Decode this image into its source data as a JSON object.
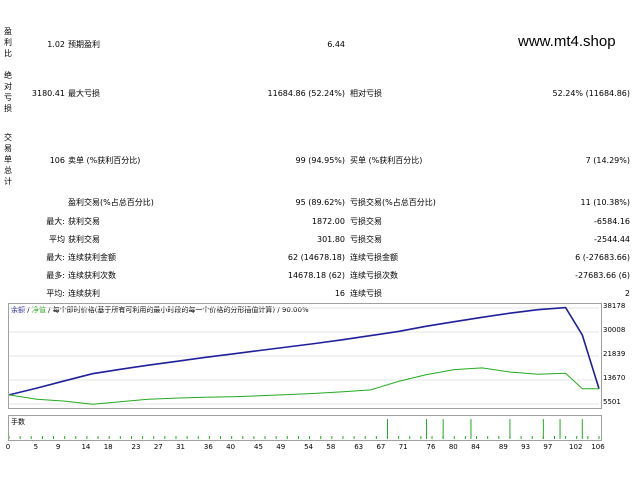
{
  "watermark": "www.mt4.shop",
  "side_labels": {
    "profit_ratio": "盈利比",
    "absolute_drawdown": "绝对亏损",
    "trade_summary": "交易单总计"
  },
  "rows": {
    "r1": {
      "left_value": "1.02",
      "label1": "预期盈利",
      "value1": "6.44"
    },
    "r2": {
      "left_value": "3180.41",
      "label1": "最大亏损",
      "value1": "11684.86 (52.24%)",
      "label2": "相对亏损",
      "value2": "52.24% (11684.86)"
    },
    "r3": {
      "left_value": "106",
      "label1": "卖单 (%获利百分比)",
      "value1": "99 (94.95%)",
      "label2": "买单 (%获利百分比)",
      "value2": "7 (14.29%)"
    },
    "r4": {
      "label1": "盈利交易(%占总百分比)",
      "value1": "95 (89.62%)",
      "label2": "亏损交易(%占总百分比)",
      "value2": "11 (10.38%)"
    },
    "r5": {
      "prefix": "最大:",
      "label1": "获利交易",
      "value1": "1872.00",
      "label2": "亏损交易",
      "value2": "-6584.16"
    },
    "r6": {
      "prefix": "平均",
      "label1": "获利交易",
      "value1": "301.80",
      "label2": "亏损交易",
      "value2": "-2544.44"
    },
    "r7": {
      "prefix": "最大:",
      "label1": "连续获利金额",
      "value1": "62 (14678.18)",
      "label2": "连续亏损金额",
      "value2": "6 (-27683.66)"
    },
    "r8": {
      "prefix": "最多:",
      "label1": "连续获利次数",
      "value1": "14678.18 (62)",
      "label2": "连续亏损次数",
      "value2": "-27683.66 (6)"
    },
    "r9": {
      "prefix": "平均:",
      "label1": "连续获利",
      "value1": "16",
      "label2": "连续亏损",
      "value2": "2"
    }
  },
  "chart": {
    "legend_balance": "余额",
    "legend_sep1": "/",
    "legend_equity": "净值",
    "legend_rest": "/ 每个即时价格(基于所有可利用的最小时段的每一个价格的分形插值计算) / 90.00%",
    "volume_label": "手数",
    "colors": {
      "balance": "#1f1f9c",
      "equity": "#22aa22",
      "volume": "#22aa22"
    }
  },
  "chart_data": {
    "type": "line",
    "x": [
      0,
      5,
      10,
      15,
      20,
      25,
      30,
      35,
      40,
      45,
      50,
      55,
      60,
      65,
      70,
      75,
      80,
      85,
      90,
      95,
      100,
      103,
      106
    ],
    "series": [
      {
        "values": [
          8600,
          10900,
          13400,
          15800,
          17300,
          18700,
          20000,
          21300,
          22500,
          23700,
          24900,
          26100,
          27400,
          28800,
          30200,
          32000,
          33500,
          35000,
          36400,
          37600,
          38300,
          29000,
          10700
        ]
      },
      {
        "values": [
          8600,
          7100,
          6500,
          5400,
          6300,
          7100,
          7500,
          7800,
          8000,
          8300,
          8700,
          9100,
          9700,
          10300,
          13200,
          15500,
          17200,
          17800,
          16400,
          15600,
          16000,
          10700,
          10700
        ]
      }
    ],
    "volume_ticks": [
      68,
      75,
      78,
      83,
      90,
      96,
      99,
      103
    ],
    "y_ticks": [
      "38178",
      "30008",
      "21839",
      "13670",
      "5501"
    ],
    "x_ticks": [
      "0",
      "5",
      "9",
      "14",
      "18",
      "23",
      "27",
      "31",
      "36",
      "40",
      "45",
      "49",
      "54",
      "58",
      "63",
      "67",
      "71",
      "76",
      "80",
      "84",
      "89",
      "93",
      "97",
      "102",
      "106"
    ],
    "ylim": [
      5501,
      38178
    ],
    "xlim": [
      0,
      106
    ]
  }
}
